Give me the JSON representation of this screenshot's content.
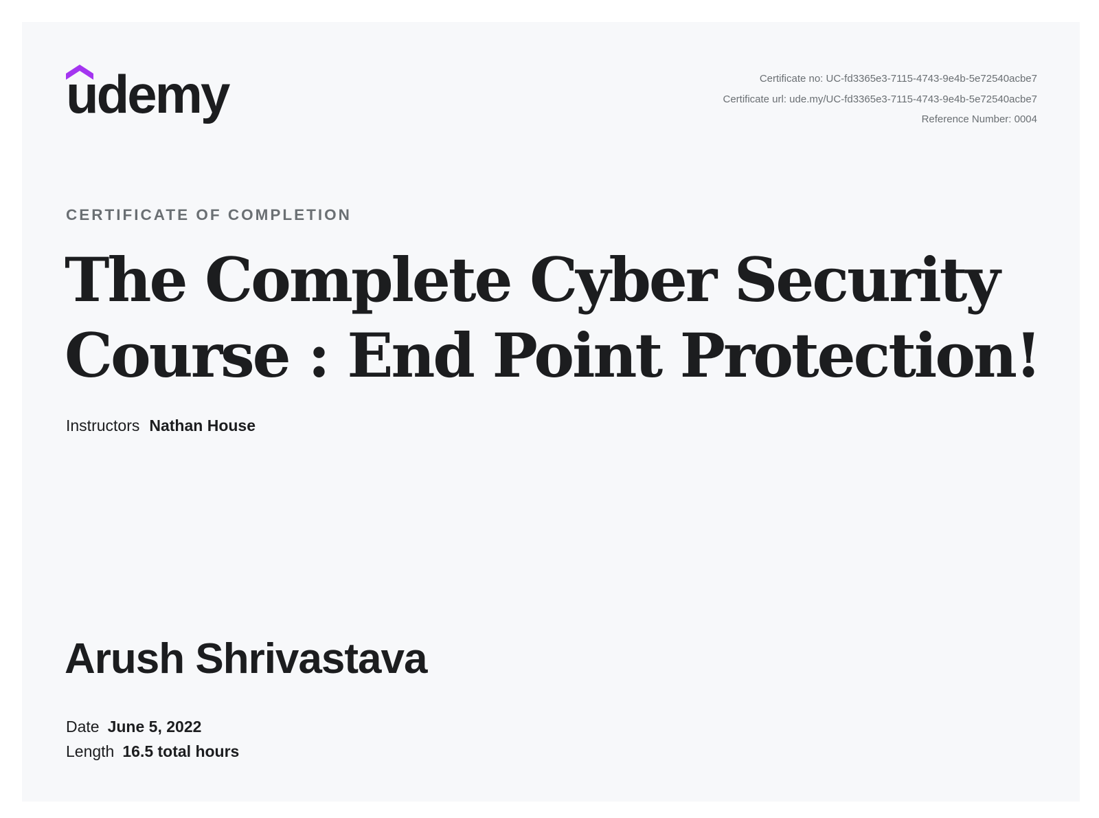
{
  "brand": {
    "logo_text": "udemy",
    "accent_color": "#a435f0"
  },
  "certificate_meta": {
    "certificate_no": "Certificate no: UC-fd3365e3-7115-4743-9e4b-5e72540acbe7",
    "certificate_url": "Certificate url: ude.my/UC-fd3365e3-7115-4743-9e4b-5e72540acbe7",
    "reference_number": "Reference Number: 0004"
  },
  "heading": {
    "label": "CERTIFICATE OF COMPLETION",
    "course_title": "The Complete Cyber Security Course : End Point Protection!"
  },
  "instructors": {
    "label": "Instructors",
    "value": "Nathan House"
  },
  "recipient": {
    "name": "Arush Shrivastava"
  },
  "details": {
    "date_label": "Date",
    "date_value": "June 5, 2022",
    "length_label": "Length",
    "length_value": "16.5 total hours"
  }
}
